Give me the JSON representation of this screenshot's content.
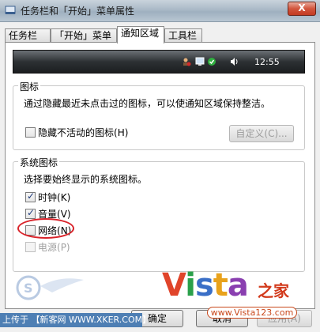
{
  "window": {
    "title": "任务栏和「开始」菜单属性",
    "close_label": "X"
  },
  "tabs": [
    {
      "label": "任务栏",
      "active": false
    },
    {
      "label": "「开始」菜单",
      "active": false
    },
    {
      "label": "通知区域",
      "active": true
    },
    {
      "label": "工具栏",
      "active": false
    }
  ],
  "preview": {
    "clock": "12:55",
    "tray_icons": [
      "network-user-icon",
      "display-icon",
      "shield-icon",
      "speaker-icon"
    ]
  },
  "icons_group": {
    "title": "图标",
    "description": "通过隐藏最近未点击过的图标，可以使通知区域保持整洁。",
    "hide_inactive": {
      "label": "隐藏不活动的图标",
      "hotkey": "(H)",
      "checked": false
    },
    "customize_button": "自定义(C)..."
  },
  "system_group": {
    "title": "系统图标",
    "description": "选择要始终显示的系统图标。",
    "items": [
      {
        "label": "时钟",
        "hotkey": "(K)",
        "checked": true,
        "disabled": false
      },
      {
        "label": "音量",
        "hotkey": "(V)",
        "checked": true,
        "disabled": false
      },
      {
        "label": "网络",
        "hotkey": "(N)",
        "checked": false,
        "disabled": false
      },
      {
        "label": "电源",
        "hotkey": "(P)",
        "checked": false,
        "disabled": true
      }
    ]
  },
  "buttons": {
    "ok": "确定",
    "cancel": "取消",
    "apply": "应用(A)"
  },
  "watermarks": {
    "left_strip": "上传于 【新客网 WWW.XKER.COM】",
    "vista_logo": "Vista",
    "vista_cn": "之家",
    "vista_url": "www.Vista123.com"
  },
  "colors": {
    "accent_red": "#d9232a",
    "vista_v": "#e0442a",
    "vista_i": "#2aa04a",
    "vista_s": "#3a6fc7",
    "vista_t": "#e8a21c",
    "vista_a": "#8a3fb0"
  }
}
